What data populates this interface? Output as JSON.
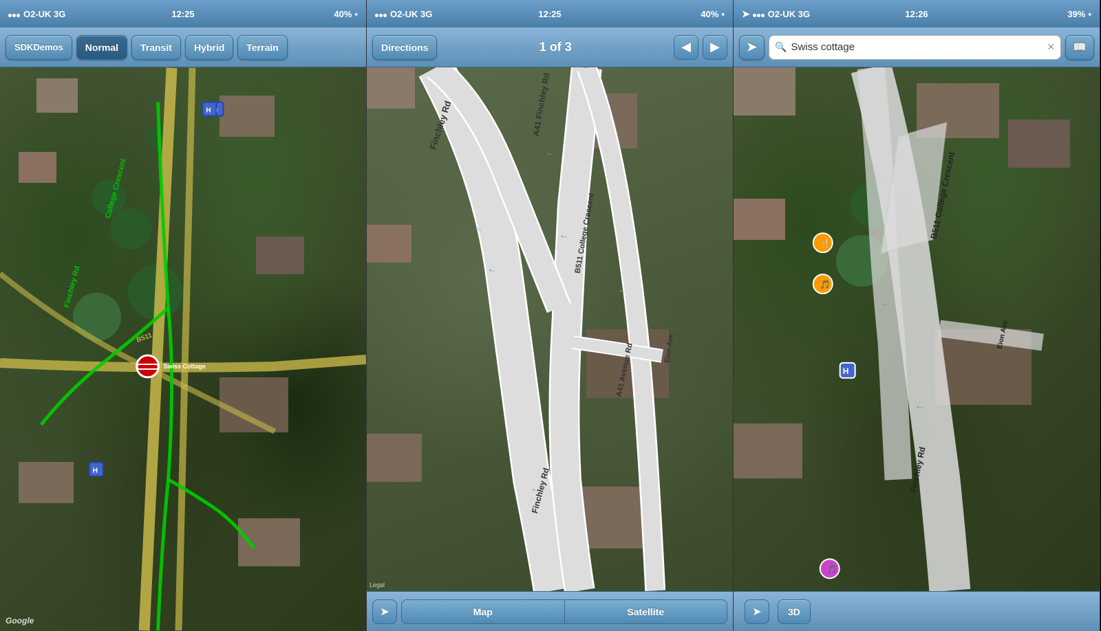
{
  "phones": [
    {
      "id": "phone1",
      "status": {
        "carrier": "O2-UK 3G",
        "time": "12:25",
        "battery": "40%"
      },
      "nav": {
        "sdk_label": "SDKDemos",
        "buttons": [
          "Normal",
          "Transit",
          "Hybrid",
          "Terrain"
        ],
        "active": "Normal"
      },
      "map": {
        "type": "hybrid_satellite",
        "labels": [
          "College Crescent",
          "Finchley Rd",
          "B511"
        ],
        "google_label": "Google"
      }
    },
    {
      "id": "phone2",
      "status": {
        "carrier": "O2-UK 3G",
        "time": "12:25",
        "battery": "40%"
      },
      "nav": {
        "back_label": "Directions",
        "counter": "1 of 3",
        "prev_arrow": "◀",
        "next_arrow": "▶"
      },
      "bottom": {
        "location_icon": "➤",
        "map_label": "Map",
        "satellite_label": "Satellite"
      },
      "map": {
        "roads": [
          "Finchley Rd",
          "A41 Finchley Rd",
          "B511 College Crescent",
          "A41 Avenue Rd",
          "Eion Ave"
        ],
        "legal": "Legal"
      }
    },
    {
      "id": "phone3",
      "status": {
        "carrier": "O2-UK 3G",
        "time": "12:26",
        "battery": "39%",
        "gps": true
      },
      "nav": {
        "back_icon": "➤",
        "search_placeholder": "Swiss cottage",
        "clear_icon": "✕",
        "bookmark_icon": "📖"
      },
      "bottom": {
        "location_icon": "➤",
        "three_d_label": "3D"
      },
      "map": {
        "roads": [
          "B511 College Crescent",
          "Finchley Rd",
          "Eion Ave"
        ],
        "markers": [
          "bus_stop",
          "restaurant",
          "entertainment"
        ]
      }
    }
  ]
}
